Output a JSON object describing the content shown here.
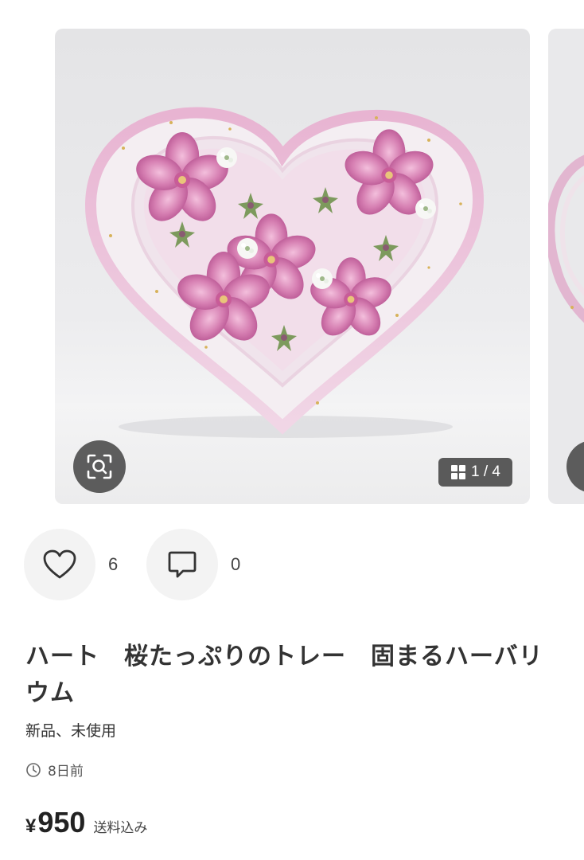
{
  "gallery": {
    "counter_current": "1",
    "counter_separator": "/",
    "counter_total": "4",
    "zoom_icon": "zoom-scan-icon",
    "grid_icon": "grid-icon"
  },
  "actions": {
    "like_icon": "heart-icon",
    "like_count": "6",
    "comment_icon": "comment-icon",
    "comment_count": "0"
  },
  "item": {
    "title": "ハート　桜たっぷりのトレー　固まるハーバリウム",
    "condition": "新品、未使用",
    "posted": "8日前",
    "currency": "¥",
    "price": "950",
    "shipping": "送料込み"
  },
  "colors": {
    "petal": "#d36fa9",
    "petal_dark": "#a8407f",
    "tray_rim": "#e4b8d2",
    "overlay": "#484848"
  }
}
